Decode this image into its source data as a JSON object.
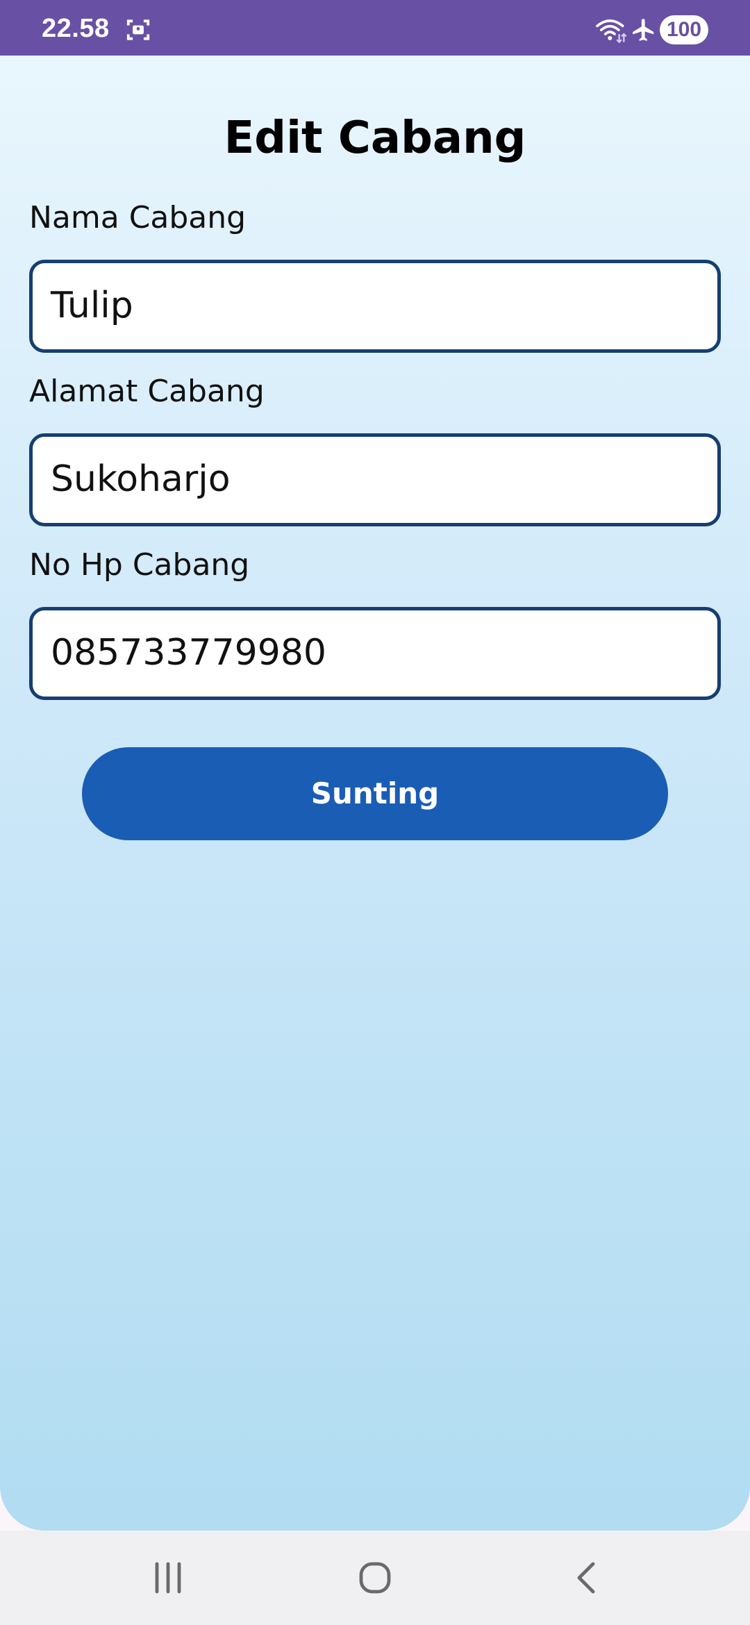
{
  "status_bar": {
    "time": "22.58",
    "battery": "100",
    "icons": [
      "screenshot-icon",
      "wifi-icon",
      "airplane-mode-icon"
    ]
  },
  "page": {
    "title": "Edit Cabang"
  },
  "form": {
    "fields": [
      {
        "label": "Nama Cabang",
        "value": "Tulip"
      },
      {
        "label": "Alamat Cabang",
        "value": "Sukoharjo"
      },
      {
        "label": "No Hp Cabang",
        "value": "085733779980"
      }
    ],
    "submit_label": "Sunting"
  },
  "nav_bar": {
    "icons": [
      "recent-apps-icon",
      "home-icon",
      "back-icon"
    ]
  },
  "colors": {
    "status_bar": "#6850a4",
    "field_border": "#163e72",
    "button": "#1a5db4",
    "background_top": "#e9f6fd",
    "background_bottom": "#b1dcf1"
  }
}
